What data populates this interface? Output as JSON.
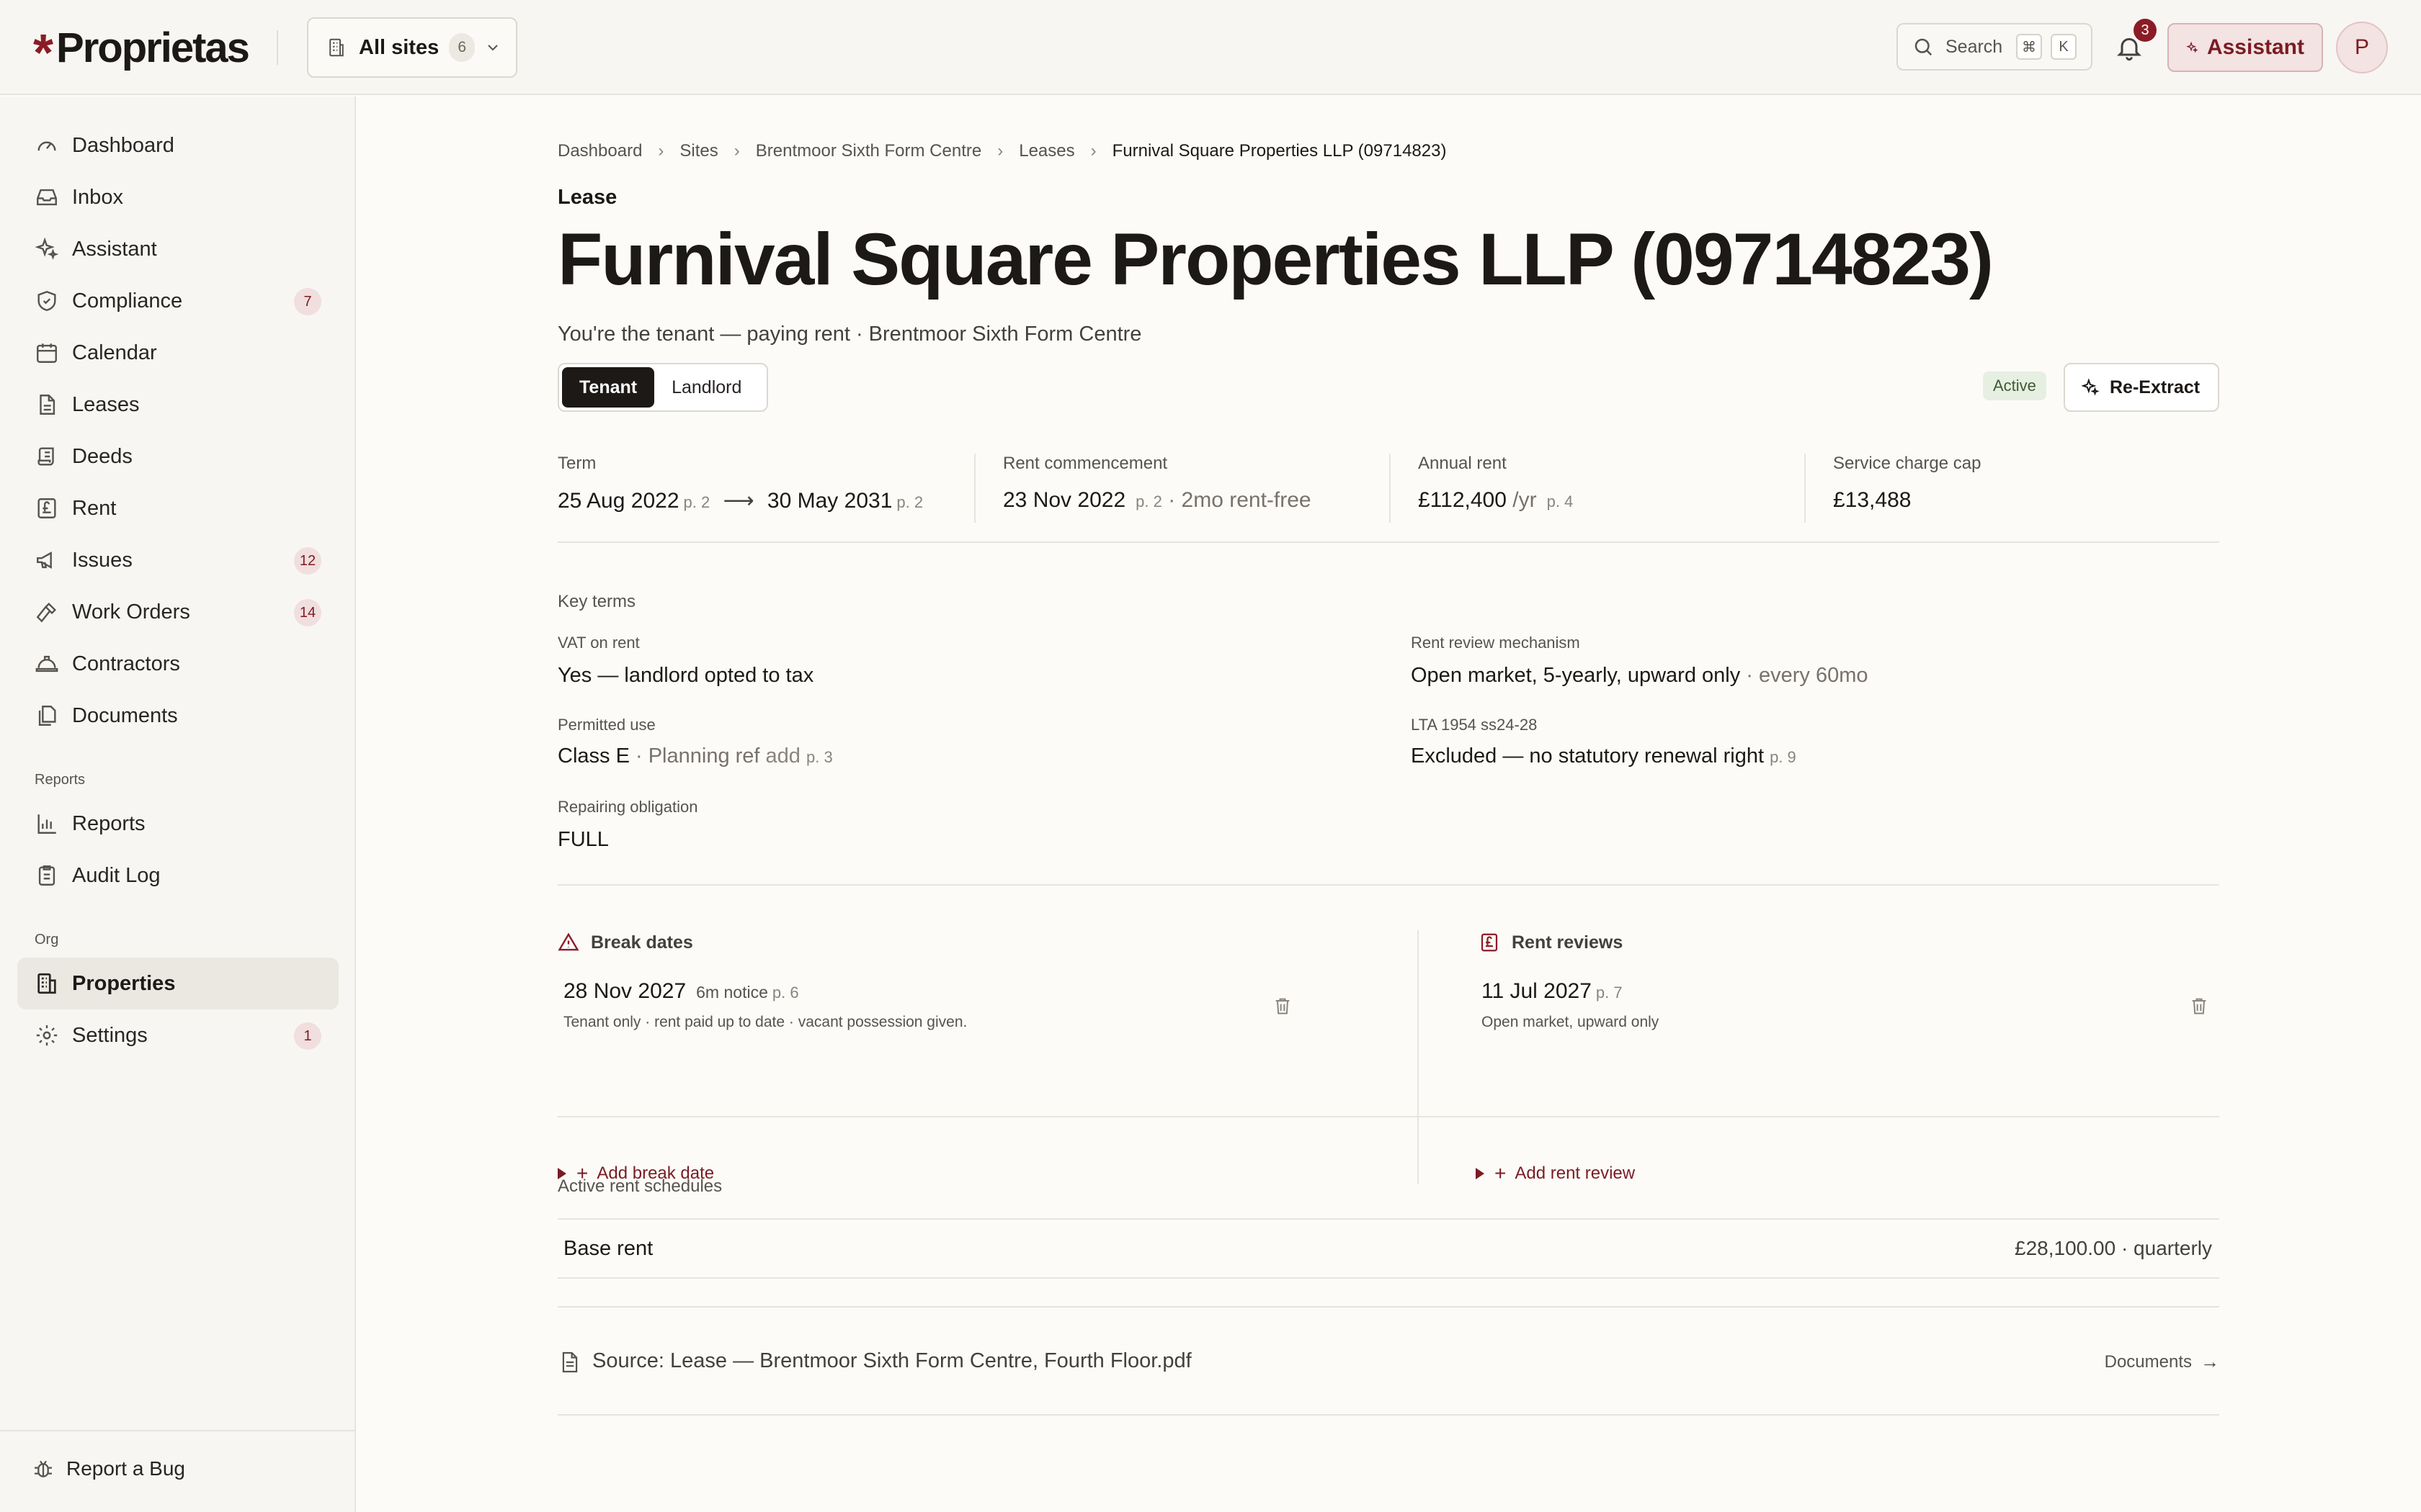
{
  "brand": {
    "star": "*",
    "name": "Proprietas",
    "accent": "#8b1c26"
  },
  "site_picker": {
    "label": "All sites",
    "count": "6",
    "icon": "building-icon"
  },
  "search": {
    "label": "Search",
    "key1": "⌘",
    "key2": "K"
  },
  "notifications": {
    "count": "3"
  },
  "assistant": {
    "label": "Assistant"
  },
  "user": {
    "initial": "P"
  },
  "sidebar": {
    "items": [
      {
        "label": "Dashboard",
        "icon": "gauge-icon",
        "badge": ""
      },
      {
        "label": "Inbox",
        "icon": "inbox-icon",
        "badge": ""
      },
      {
        "label": "Assistant",
        "icon": "sparkle-icon",
        "badge": ""
      },
      {
        "label": "Compliance",
        "icon": "shield-icon",
        "badge": "7"
      },
      {
        "label": "Calendar",
        "icon": "calendar-icon",
        "badge": ""
      },
      {
        "label": "Leases",
        "icon": "file-icon",
        "badge": ""
      },
      {
        "label": "Deeds",
        "icon": "scroll-icon",
        "badge": ""
      },
      {
        "label": "Rent",
        "icon": "pound-icon",
        "badge": ""
      },
      {
        "label": "Issues",
        "icon": "megaphone-icon",
        "badge": "12"
      },
      {
        "label": "Work Orders",
        "icon": "hammer-icon",
        "badge": "14"
      },
      {
        "label": "Contractors",
        "icon": "hardhat-icon",
        "badge": ""
      },
      {
        "label": "Documents",
        "icon": "files-icon",
        "badge": ""
      }
    ],
    "reports_section": "Reports",
    "reports_items": [
      {
        "label": "Reports",
        "icon": "bar-chart-icon"
      },
      {
        "label": "Audit Log",
        "icon": "clipboard-icon"
      }
    ],
    "org_section": "Org",
    "org_items": [
      {
        "label": "Properties",
        "icon": "building-icon",
        "badge": ""
      },
      {
        "label": "Settings",
        "icon": "gear-icon",
        "badge": "1"
      }
    ],
    "report_bug": "Report a Bug"
  },
  "breadcrumb": [
    "Dashboard",
    "Sites",
    "Brentmoor Sixth Form Centre",
    "Leases",
    "Furnival Square Properties LLP (09714823)"
  ],
  "page": {
    "eyebrow": "Lease",
    "title": "Furnival Square Properties LLP (09714823)",
    "subtitle": "You're the tenant — paying rent · Brentmoor Sixth Form Centre",
    "toggle": [
      "Tenant",
      "Landlord"
    ],
    "status": "Active",
    "reextract": "Re-Extract"
  },
  "stats": {
    "term": {
      "label": "Term",
      "start": "25 Aug 2022",
      "start_ref": "p. 2",
      "arrow": "⟶",
      "end": "30 May 2031",
      "end_ref": "p. 2"
    },
    "commencement": {
      "label": "Rent commencement",
      "date": "23 Nov 2022",
      "ref": "p. 2",
      "extra": "· 2mo rent-free"
    },
    "annual_rent": {
      "label": "Annual rent",
      "value": "£112,400",
      "unit": "/yr",
      "ref": "p. 4"
    },
    "service_cap": {
      "label": "Service charge cap",
      "value": "£13,488"
    }
  },
  "key_terms": {
    "heading": "Key terms",
    "vat": {
      "label": "VAT on rent",
      "value": "Yes — landlord opted to tax"
    },
    "review": {
      "label": "Rent review mechanism",
      "value": "Open market, 5-yearly, upward only",
      "extra": "· every 60mo"
    },
    "use": {
      "label": "Permitted use",
      "value": "Class E",
      "extra": "· Planning ref",
      "add": "add",
      "ref": "p. 3"
    },
    "lta": {
      "label": "LTA 1954 ss24-28",
      "value": "Excluded — no statutory renewal right",
      "ref": "p. 9"
    },
    "repair": {
      "label": "Repairing obligation",
      "value": "FULL"
    }
  },
  "break_dates": {
    "heading": "Break dates",
    "date": "28 Nov 2027",
    "notice": "6m notice",
    "ref": "p. 6",
    "note": "Tenant only · rent paid up to date · vacant possession given.",
    "add": "Add break date"
  },
  "rent_reviews": {
    "heading": "Rent reviews",
    "date": "11 Jul 2027",
    "ref": "p. 7",
    "note": "Open market, upward only",
    "add": "Add rent review"
  },
  "schedules": {
    "heading": "Active rent schedules",
    "label": "Base rent",
    "value": "£28,100.00 · quarterly"
  },
  "source": {
    "text": "Source: Lease — Brentmoor Sixth Form Centre, Fourth Floor.pdf",
    "link": "Documents",
    "arrow": "→"
  }
}
